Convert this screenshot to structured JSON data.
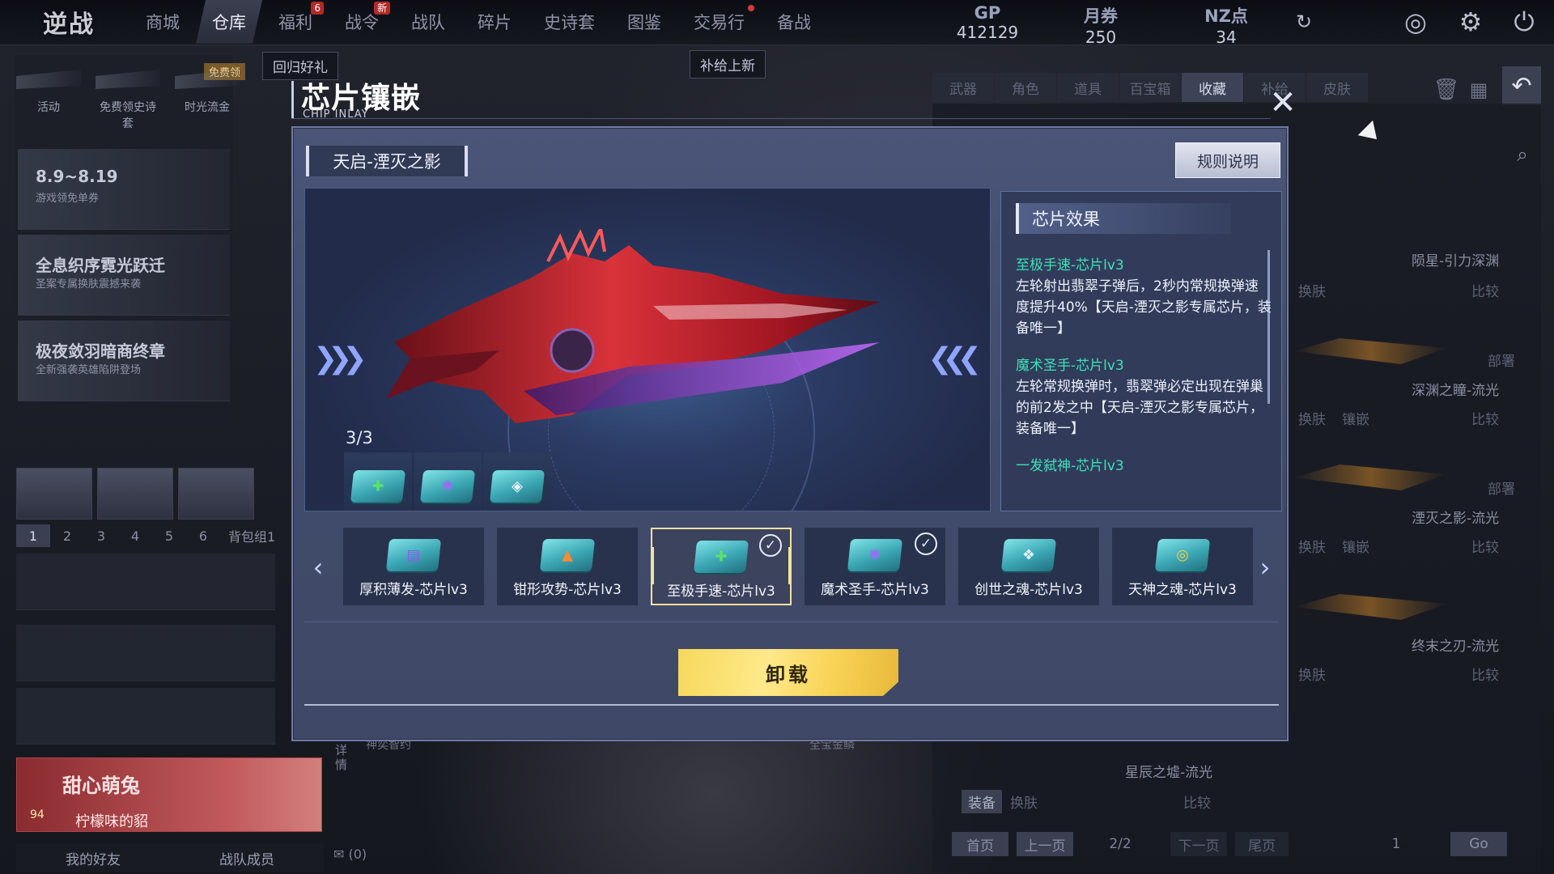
{
  "app": {
    "logo": "逆战",
    "nav": [
      {
        "label": "商城",
        "active": false
      },
      {
        "label": "仓库",
        "active": true
      },
      {
        "label": "福利",
        "active": false,
        "badge": "6"
      },
      {
        "label": "战令",
        "active": false,
        "badge": "新"
      },
      {
        "label": "战队",
        "active": false
      },
      {
        "label": "碎片",
        "active": false
      },
      {
        "label": "史诗套",
        "active": false
      },
      {
        "label": "图鉴",
        "active": false
      },
      {
        "label": "交易行",
        "active": false,
        "dot": true
      },
      {
        "label": "备战",
        "active": false
      }
    ],
    "currencies": [
      {
        "label": "GP",
        "value": "412129"
      },
      {
        "label": "月券",
        "value": "250"
      },
      {
        "label": "NZ点",
        "value": "34"
      }
    ],
    "tips": {
      "return_gift": "回归好礼",
      "restock": "补给上新"
    }
  },
  "left": {
    "free_tag": "免费领",
    "activities": [
      "活动",
      "免费领史诗套",
      "时光流金"
    ],
    "promos": [
      {
        "title": "8.9~8.19",
        "sub": "游戏领免单券"
      },
      {
        "title": "全息织序霓光跃迁",
        "sub": "圣案专属换肤震撼来袭"
      },
      {
        "title": "极夜敛羽暗商终章",
        "sub": "全新强袭英雄陷阱登场"
      }
    ],
    "bag_tabs": [
      "1",
      "2",
      "3",
      "4",
      "5",
      "6"
    ],
    "bag_label": "背包组1",
    "profile": {
      "name": "甜心萌兔",
      "level": "94",
      "guild": "柠檬味的貂"
    },
    "friend_tabs": [
      "我的好友",
      "战队成员"
    ],
    "mail": "(0)",
    "side_labels": {
      "detail": "详情",
      "godlike": "神奕智约",
      "full_gold": "全宝金鳞"
    }
  },
  "right": {
    "tabs": [
      {
        "label": "武器",
        "active": false
      },
      {
        "label": "角色",
        "active": false
      },
      {
        "label": "道具",
        "active": false
      },
      {
        "label": "百宝箱",
        "active": false
      },
      {
        "label": "收藏",
        "active": true
      },
      {
        "label": "补给",
        "active": false
      },
      {
        "label": "皮肤",
        "active": false
      }
    ],
    "items": [
      {
        "name": "陨星-引力深渊",
        "btns": [
          "换肤",
          "比较"
        ]
      },
      {
        "name": "深渊之瞳-流光",
        "btns": [
          "部署",
          "换肤",
          "镶嵌",
          "比较"
        ]
      },
      {
        "name": "湮灭之影-流光",
        "btns": [
          "部署",
          "换肤",
          "镶嵌",
          "比较"
        ]
      },
      {
        "name": "终末之刃-流光",
        "btns": [
          "换肤",
          "比较"
        ]
      },
      {
        "name": "星辰之墟-流光",
        "btns": [
          "装备",
          "换肤",
          "比较"
        ]
      }
    ],
    "pager": {
      "first": "首页",
      "prev": "上一页",
      "page": "2/2",
      "next": "下一页",
      "last": "尾页",
      "input": "1",
      "go": "Go"
    }
  },
  "modal": {
    "title": "芯片镶嵌",
    "subtitle": "CHIP INLAY",
    "weapon_name": "天启-湮灭之影",
    "rules_button": "规则说明",
    "slot_count": "3/3",
    "effects_title": "芯片效果",
    "effects": [
      {
        "name": "至极手速-芯片lv3",
        "desc": "左轮射出翡翠子弹后，2秒内常规换弹速度提升40%【天启-湮灭之影专属芯片，装备唯一】"
      },
      {
        "name": "魔术圣手-芯片lv3",
        "desc": "左轮常规换弹时，翡翠弹必定出现在弹巢的前2发之中【天启-湮灭之影专属芯片，装备唯一】"
      },
      {
        "name": "一发弑神-芯片lv3",
        "desc": ""
      }
    ],
    "chips": [
      {
        "name": "厚积薄发-芯片lv3",
        "symbol": "▤",
        "color": "#8a5cf0",
        "selected": false,
        "checked": false
      },
      {
        "name": "钳形攻势-芯片lv3",
        "symbol": "▲",
        "color": "#ff8a2a",
        "selected": false,
        "checked": false
      },
      {
        "name": "至极手速-芯片lv3",
        "symbol": "✚",
        "color": "#5be06a",
        "selected": true,
        "checked": true
      },
      {
        "name": "魔术圣手-芯片lv3",
        "symbol": "✺",
        "color": "#9a6cf5",
        "selected": false,
        "checked": true
      },
      {
        "name": "创世之魂-芯片lv3",
        "symbol": "❖",
        "color": "#e8f1ff",
        "selected": false,
        "checked": false
      },
      {
        "name": "天神之魂-芯片lv3",
        "symbol": "◎",
        "color": "#ffd040",
        "selected": false,
        "checked": false
      }
    ],
    "mini_slots": [
      {
        "symbol": "✚",
        "color": "#5be06a"
      },
      {
        "symbol": "✺",
        "color": "#9a6cf5"
      },
      {
        "symbol": "◈",
        "color": "#f2f4fb"
      }
    ],
    "unload_button": "卸载"
  }
}
